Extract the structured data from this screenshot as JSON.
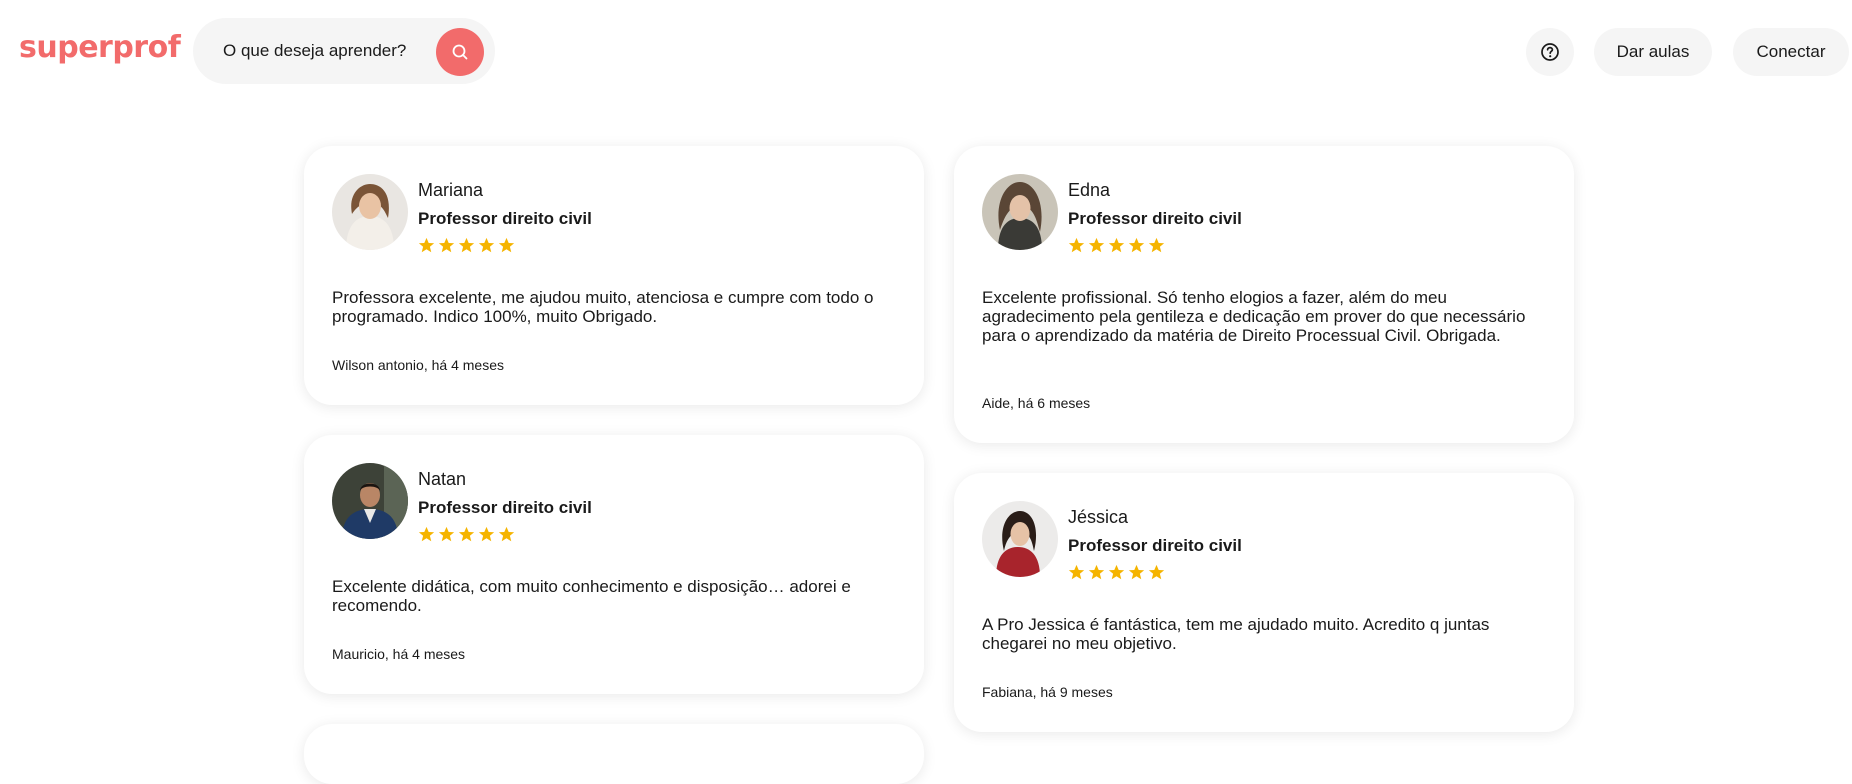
{
  "header": {
    "logo": "superprof",
    "search_label": "O que deseja aprender?",
    "help_icon": "question-circle-icon",
    "teach_label": "Dar aulas",
    "login_label": "Conectar"
  },
  "colors": {
    "brand": "#f26b6b",
    "button_bg": "#f5f5f5",
    "star": "#f5b400"
  },
  "reviews": [
    {
      "name": "Mariana",
      "title": "Professor direito civil",
      "rating": 5,
      "text": "Professora excelente, me ajudou muito, atenciosa e cumpre com todo o programado. Indico 100%, muito Obrigado.",
      "author": "Wilson antonio, há 4 meses"
    },
    {
      "name": "Edna",
      "title": "Professor direito civil",
      "rating": 5,
      "text": "Excelente profissional. Só tenho elogios a fazer, além do meu agradecimento pela gentileza e dedicação em prover do que necessário para o aprendizado da matéria de Direito Processual Civil. Obrigada.",
      "author": "Aide, há 6 meses"
    },
    {
      "name": "Natan",
      "title": "Professor direito civil",
      "rating": 5,
      "text": "Excelente didática, com muito conhecimento e disposição… adorei e recomendo.",
      "author": "Mauricio, há 4 meses"
    },
    {
      "name": "Jéssica",
      "title": "Professor direito civil",
      "rating": 5,
      "text": "A Pro Jessica é fantástica, tem me ajudado muito. Acredito q juntas chegarei no meu objetivo.",
      "author": "Fabiana, há 9 meses"
    }
  ]
}
